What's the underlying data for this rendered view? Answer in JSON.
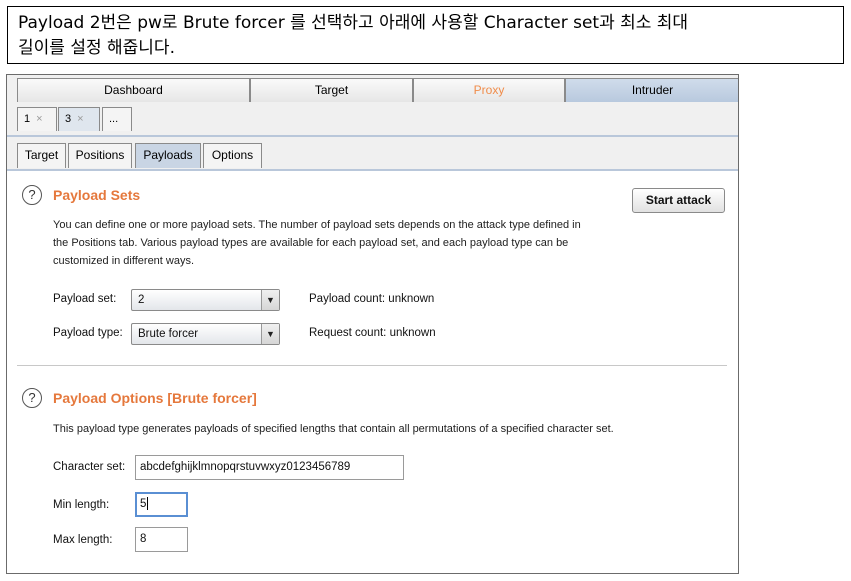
{
  "caption": {
    "line1": "Payload 2번은 pw로 Brute forcer 를 선택하고 아래에 사용할 Character set과 최소 최대",
    "line2": "길이를 설정 해줍니다."
  },
  "main_tabs": [
    "Dashboard",
    "Target",
    "Proxy",
    "Intruder"
  ],
  "sub_tabs": [
    {
      "label": "1",
      "close": "×"
    },
    {
      "label": "3",
      "close": "×"
    },
    {
      "label": "..."
    }
  ],
  "panel_tabs": [
    "Target",
    "Positions",
    "Payloads",
    "Options"
  ],
  "payload_sets": {
    "help": "?",
    "title": "Payload Sets",
    "start_attack": "Start attack",
    "desc_line1": "You can define one or more payload sets. The number of payload sets depends on the attack type defined in",
    "desc_line2": "the Positions tab. Various payload types are available for each payload set, and each payload type can be",
    "desc_line3": "customized in different ways.",
    "payload_set_label": "Payload set:",
    "payload_set_value": "2",
    "payload_count_label": "Payload count:",
    "payload_count_value": "unknown",
    "payload_type_label": "Payload type:",
    "payload_type_value": "Brute forcer",
    "request_count_label": "Request count:",
    "request_count_value": "unknown"
  },
  "payload_options": {
    "help": "?",
    "title": "Payload Options [Brute forcer]",
    "desc": "This payload type generates payloads of specified lengths that contain all permutations of a specified character set.",
    "charset_label": "Character set:",
    "charset_value": "abcdefghijklmnopqrstuvwxyz0123456789",
    "min_label": "Min length:",
    "min_value": "5",
    "max_label": "Max length:",
    "max_value": "8"
  },
  "colors": {
    "accent": "#e5783c",
    "proxy_tab": "#f08c4a",
    "active_tab": "#b8c9de"
  },
  "icons": {
    "dropdown": "▼",
    "help": "question-circle-icon"
  }
}
